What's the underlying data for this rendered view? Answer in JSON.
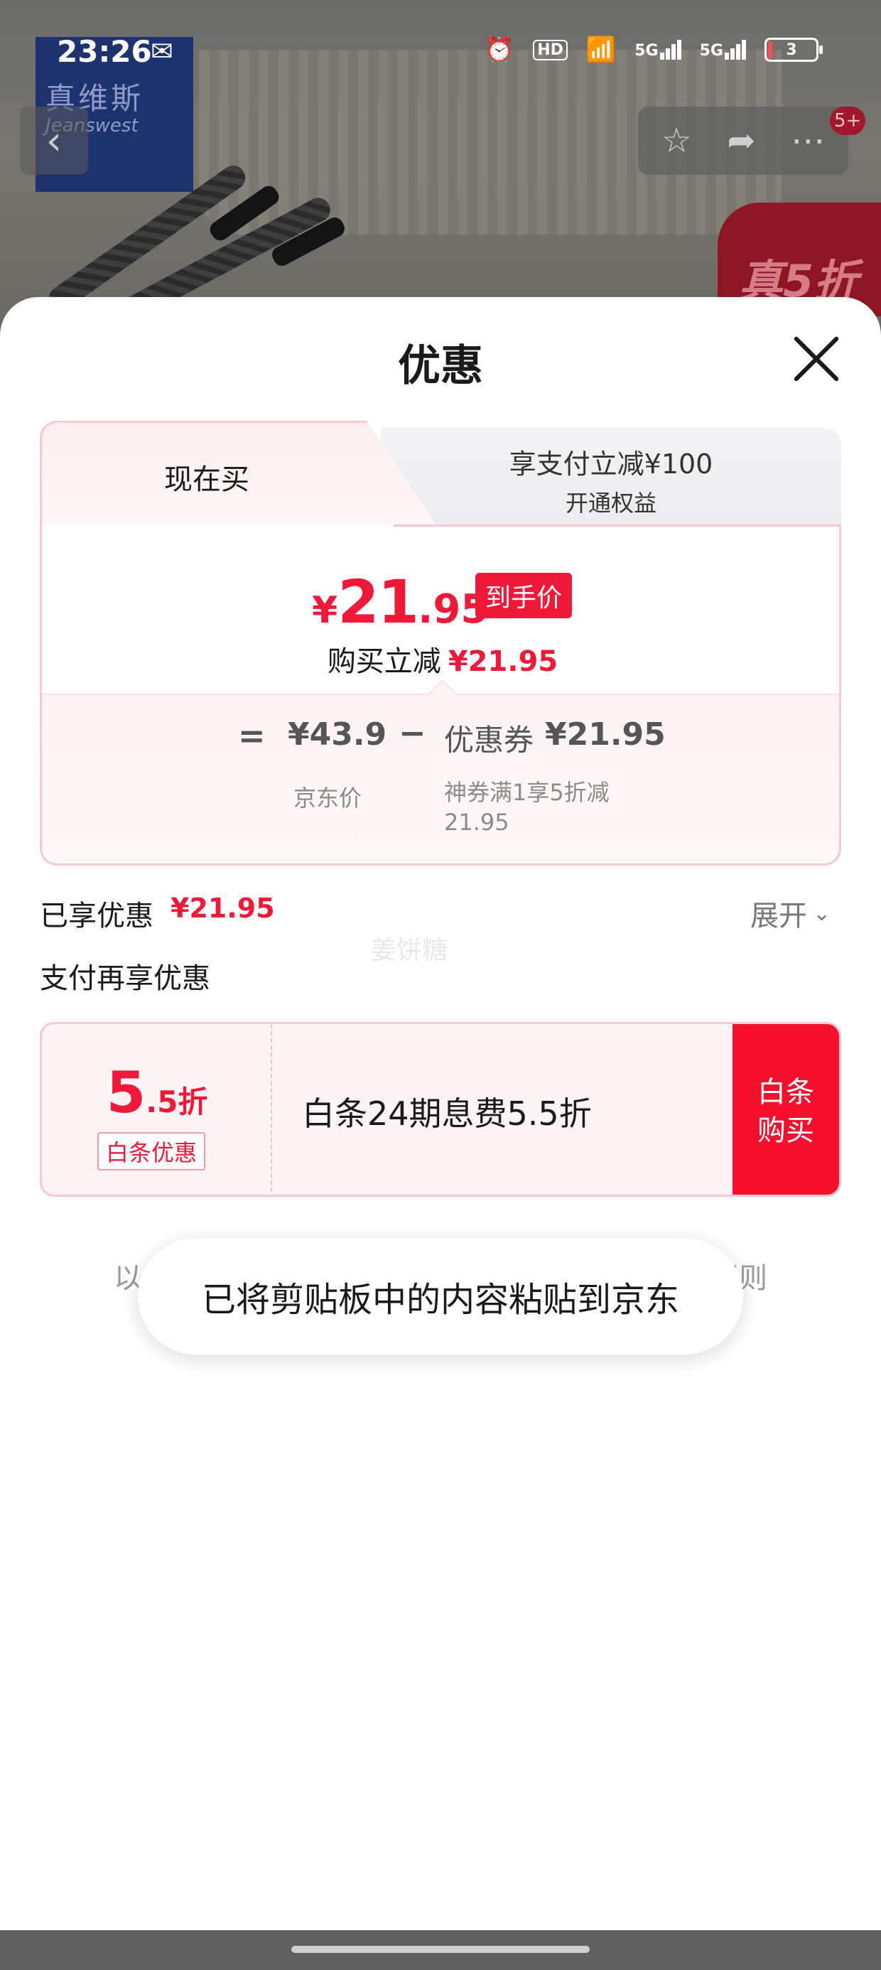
{
  "status_bar": {
    "time": "23:26",
    "icons": [
      "wechat-icon",
      "alarm-icon",
      "hd-icon",
      "wifi-icon",
      "5g-signal-icon",
      "5g-signal-icon",
      "battery-icon"
    ],
    "hd_label": "HD",
    "network_1": "5G",
    "network_2": "5G",
    "battery_level": "3"
  },
  "background": {
    "brand_cn": "真维斯",
    "brand_en": "Jeanswest",
    "badge_count": "5+",
    "promo_tag": "真5折"
  },
  "sheet": {
    "title": "优惠",
    "tabs": {
      "active_label": "现在买",
      "secondary_title": "享支付立减¥100",
      "secondary_sub": "开通权益"
    },
    "final_price": {
      "currency": "¥",
      "integer": "21",
      "decimal": ".95",
      "badge": "到手价"
    },
    "reduce": {
      "label": "购买立减",
      "amount": "¥21.95"
    },
    "breakdown": {
      "equals": "=",
      "jd_price": "¥43.9",
      "jd_price_caption": "京东价",
      "minus": "−",
      "coupon_label": "优惠券",
      "coupon_amount": "¥21.95",
      "coupon_caption": "神券满1享5折减21.95"
    },
    "enjoyed": {
      "label": "已享优惠",
      "amount": "¥21.95",
      "expand_label": "展开"
    },
    "watermark": "姜饼糖",
    "pay_more_label": "支付再享优惠",
    "baitiao": {
      "rate_big": "5",
      "rate_small": ".5折",
      "tag": "白条优惠",
      "description": "白条24期息费5.5折",
      "buy_line1": "白条",
      "buy_line2": "购买"
    },
    "disclaimer": "以上仅为初步预估，不代表最终价格，点击查看规则"
  },
  "toast": {
    "message": "已将剪贴板中的内容粘贴到京东"
  },
  "colors": {
    "accent_red": "#f0193a",
    "card_border": "#f7c9ce",
    "card_tint": "#fff4f5"
  }
}
